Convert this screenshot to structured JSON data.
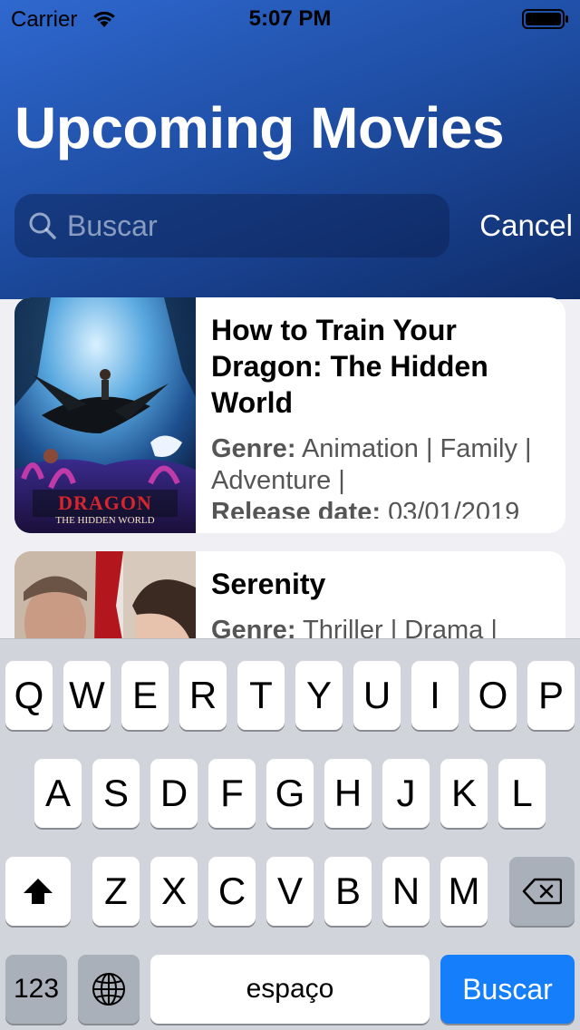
{
  "status_bar": {
    "carrier": "Carrier",
    "time": "5:07 PM",
    "wifi_icon": "wifi-icon",
    "battery_icon": "battery-icon"
  },
  "header": {
    "title": "Upcoming Movies",
    "gradient_colors": [
      "#2f68cf",
      "#0f2c6a"
    ]
  },
  "search": {
    "placeholder": "Buscar",
    "value": "",
    "icon": "search-icon",
    "cancel_label": "Cancel"
  },
  "movies": [
    {
      "title": "How to Train Your Dragon: The Hidden World",
      "genre_label": "Genre:",
      "genre": "Animation | Family | Adventure |",
      "release_label": "Release date:",
      "release_date": "03/01/2019",
      "poster_title_line1": "DRAGON",
      "poster_title_line2": "THE HIDDEN WORLD"
    },
    {
      "title": "Serenity",
      "genre_label": "Genre:",
      "genre": "Thriller | Drama |"
    }
  ],
  "keyboard": {
    "row1": [
      "Q",
      "W",
      "E",
      "R",
      "T",
      "Y",
      "U",
      "I",
      "O",
      "P"
    ],
    "row2": [
      "A",
      "S",
      "D",
      "F",
      "G",
      "H",
      "J",
      "K",
      "L"
    ],
    "row3": [
      "Z",
      "X",
      "C",
      "V",
      "B",
      "N",
      "M"
    ],
    "numbers_label": "123",
    "space_label": "espaço",
    "return_label": "Buscar",
    "shift_icon": "shift-icon",
    "delete_icon": "delete-icon",
    "globe_icon": "globe-icon",
    "accent_color": "#147efb"
  }
}
